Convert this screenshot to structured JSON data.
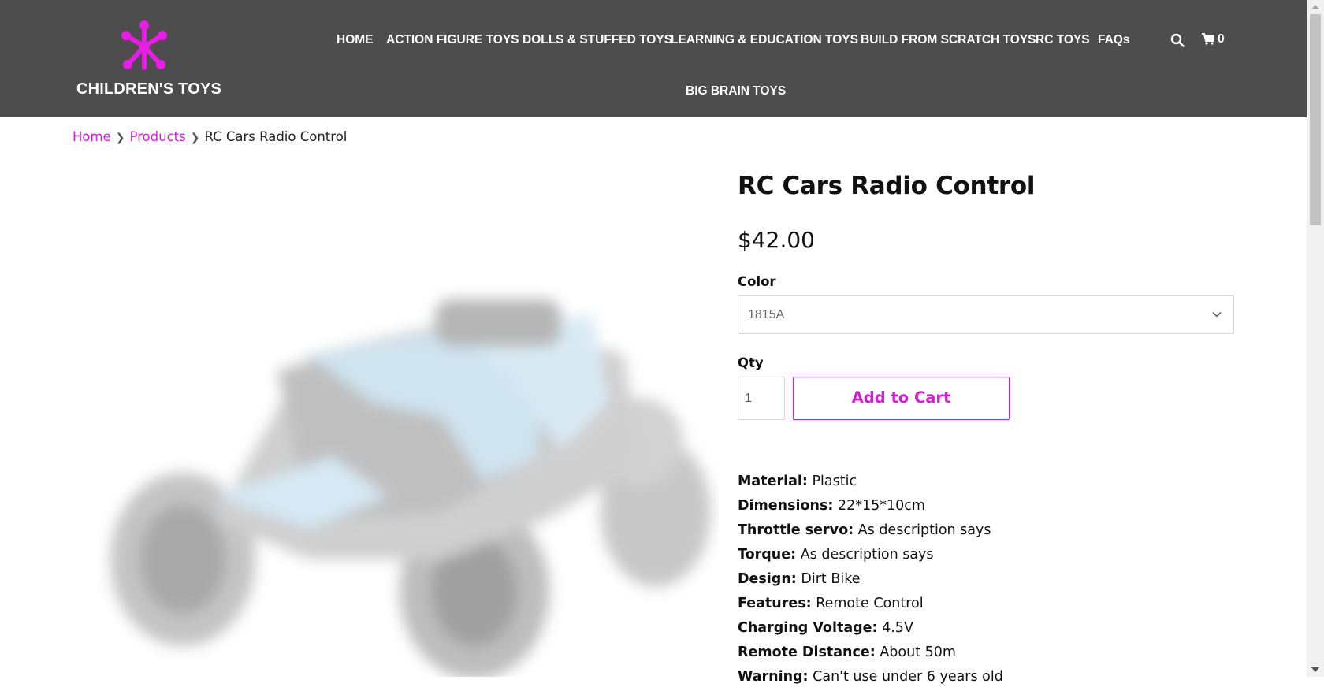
{
  "header": {
    "logo_text": "CHILDREN'S TOYS",
    "brand_color": "#e61ee6",
    "nav": [
      {
        "label": "HOME"
      },
      {
        "label": "ACTION FIGURE TOYS"
      },
      {
        "label": "DOLLS & STUFFED TOYS"
      },
      {
        "label": "LEARNING & EDUCATION TOYS"
      },
      {
        "label": "BUILD FROM SCRATCH TOYS"
      },
      {
        "label": "RC TOYS"
      },
      {
        "label": "FAQs"
      },
      {
        "label": "BIG BRAIN TOYS"
      }
    ],
    "cart_count": "0"
  },
  "breadcrumb": {
    "home": "Home",
    "products": "Products",
    "current": "RC Cars Radio Control"
  },
  "product": {
    "title": "RC Cars Radio Control",
    "price": "$42.00",
    "color_label": "Color",
    "color_value": "1815A",
    "qty_label": "Qty",
    "qty_value": "1",
    "add_to_cart": "Add to Cart",
    "specs": [
      {
        "key": "Material:",
        "value": "Plastic"
      },
      {
        "key": "Dimensions:",
        "value": "22*15*10cm"
      },
      {
        "key": "Throttle servo:",
        "value": "As description says"
      },
      {
        "key": "Torque:",
        "value": "As description says"
      },
      {
        "key": "Design:",
        "value": "Dirt Bike"
      },
      {
        "key": "Features:",
        "value": "Remote Control"
      },
      {
        "key": "Charging Voltage:",
        "value": "4.5V"
      },
      {
        "key": "Remote Distance:",
        "value": "About 50m"
      },
      {
        "key": "Warning:",
        "value": "Can't use under 6 years old"
      }
    ]
  },
  "colors": {
    "header_bg": "#4d4d4d",
    "accent": "#d11fd6"
  }
}
